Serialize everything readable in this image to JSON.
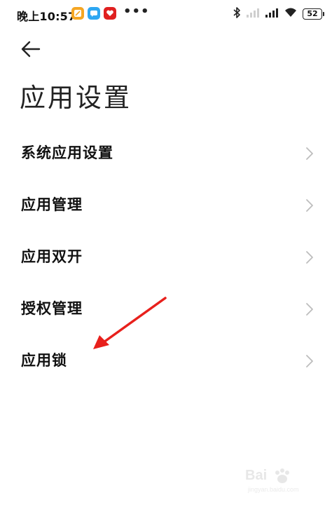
{
  "status_bar": {
    "time": "晚上10:57",
    "more": "•••",
    "battery": "52",
    "icons": [
      "notes-app-icon",
      "chat-app-icon",
      "red-app-icon",
      "bluetooth-icon",
      "signal-icon-1",
      "signal-icon-2",
      "wifi-icon",
      "battery-icon"
    ]
  },
  "header": {
    "back_icon": "arrow-left-icon",
    "title": "应用设置"
  },
  "menu": {
    "items": [
      {
        "label": "系统应用设置"
      },
      {
        "label": "应用管理"
      },
      {
        "label": "应用双开"
      },
      {
        "label": "授权管理"
      },
      {
        "label": "应用锁"
      }
    ]
  },
  "annotation": {
    "color": "#e8201c",
    "points_to": "应用锁"
  },
  "watermark": {
    "text": "Bai",
    "sub": "jingyan.baidu.com"
  }
}
